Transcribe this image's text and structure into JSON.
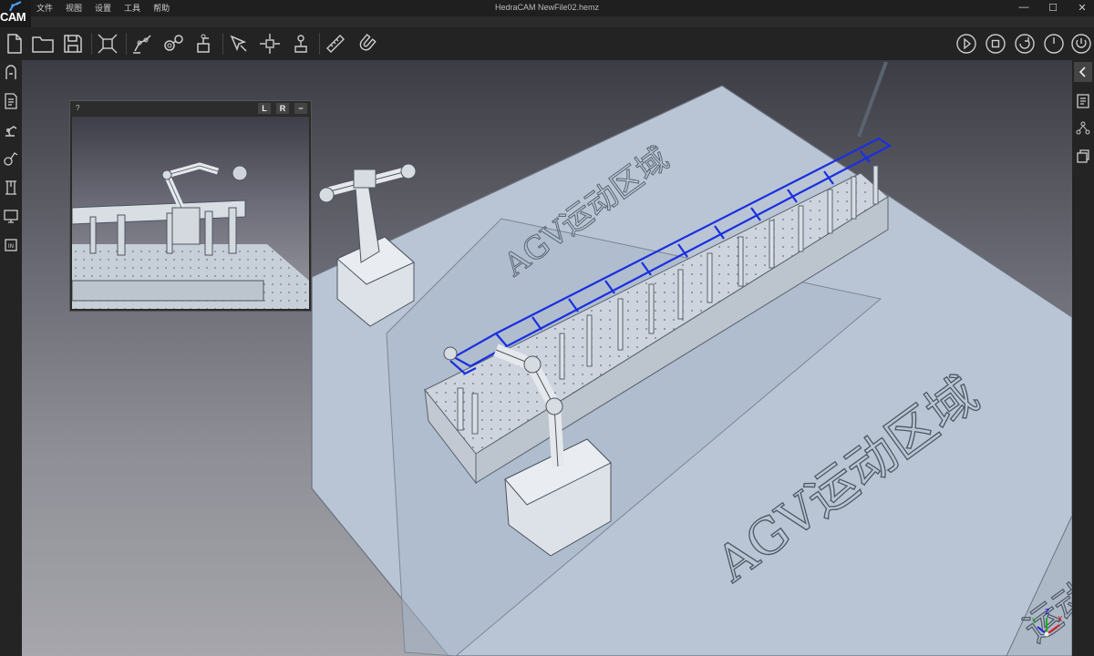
{
  "app": {
    "logo_text": "CAM",
    "window_title": "HedraCAM   NewFile02.hemz",
    "window_controls": {
      "minimize": "—",
      "maximize": "☐",
      "close": "✕"
    }
  },
  "menu": [
    "文件",
    "视图",
    "设置",
    "工具",
    "帮助"
  ],
  "toolbar": {
    "left_icons": [
      "new-file-icon",
      "open-folder-icon",
      "save-icon",
      "transform-icon",
      "robot-path-icon",
      "gear-settings-icon",
      "robot-config-icon",
      "select-point-icon",
      "move-icon",
      "joint-icon",
      "measure-icon",
      "magnet-icon"
    ],
    "right_icons": [
      "play-icon",
      "stop-icon",
      "reset-icon",
      "timer-icon",
      "power-icon"
    ]
  },
  "left_sidebar_icons": [
    "robot-library-icon",
    "document-edit-icon",
    "robot-arm-icon",
    "process-icon",
    "gantry-icon",
    "display-icon",
    "io-icon"
  ],
  "right_sidebar_icons": [
    "collapse-panel-icon",
    "doc-list-icon",
    "network-icon",
    "layers-icon"
  ],
  "inset_view": {
    "help_label": "?",
    "left_button": "L",
    "right_button": "R",
    "minimize_button": "−"
  },
  "scene": {
    "floor_label_top": "AGV运动区域",
    "floor_label_bottom": "AGV运动区域",
    "floor_label_corner": "运动"
  },
  "axis_gizmo": {
    "x": "X",
    "y": "Y",
    "z": "Z"
  },
  "colors": {
    "path_highlight": "#1a2fe0",
    "floor": "#b7c4d3",
    "machine": "#d8dde3"
  }
}
